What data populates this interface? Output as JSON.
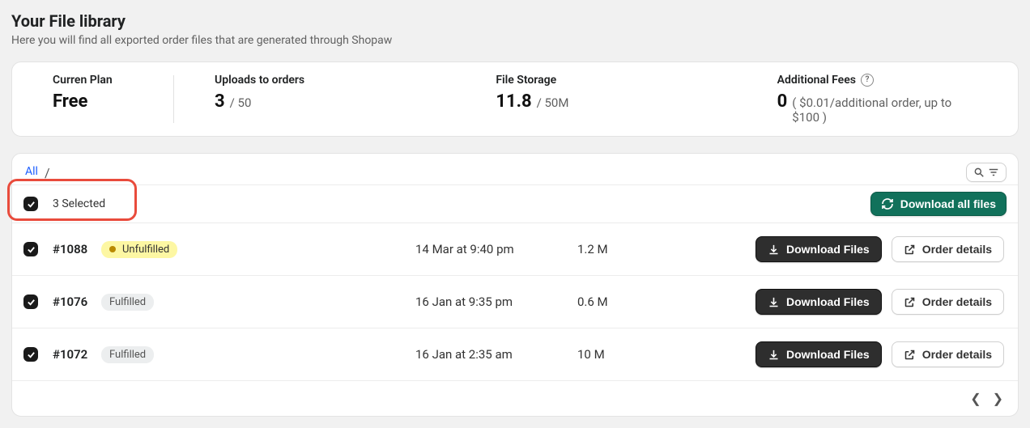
{
  "header": {
    "title": "Your File library",
    "subtitle": "Here you will find all exported order files that are generated through Shopaw"
  },
  "stats": {
    "plan": {
      "label": "Curren Plan",
      "value": "Free"
    },
    "uploads": {
      "label": "Uploads to orders",
      "value": "3",
      "sub": "/ 50"
    },
    "storage": {
      "label": "File Storage",
      "value": "11.8",
      "sub": "/ 50M"
    },
    "fees": {
      "label": "Additional Fees",
      "value": "0",
      "sub": "( $0.01/additional order, up to $100 )"
    }
  },
  "tabs": {
    "all": "All",
    "sep": "/"
  },
  "selection": {
    "count_label": "3 Selected",
    "download_all": "Download all files"
  },
  "actions": {
    "download": "Download Files",
    "details": "Order details"
  },
  "rows": [
    {
      "id": "#1088",
      "status": "Unfulfilled",
      "status_kind": "yellow",
      "date": "14 Mar at 9:40 pm",
      "size": "1.2 M"
    },
    {
      "id": "#1076",
      "status": "Fulfilled",
      "status_kind": "gray",
      "date": "16 Jan at 9:35 pm",
      "size": "0.6 M"
    },
    {
      "id": "#1072",
      "status": "Fulfilled",
      "status_kind": "gray",
      "date": "16 Jan at 2:35 am",
      "size": "10 M"
    }
  ]
}
